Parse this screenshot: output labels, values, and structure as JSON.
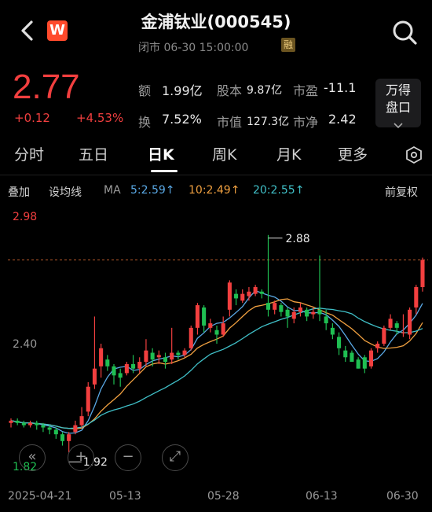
{
  "header": {
    "title": "金浦钛业(000545)",
    "status": "闭市 06-30 15:00:00",
    "margin_badge": "融",
    "logo_letter": "W"
  },
  "quote": {
    "price": "2.77",
    "change": "+0.12",
    "change_pct": "+4.53%",
    "stats": [
      {
        "label": "额",
        "value": "1.99亿"
      },
      {
        "label": "股本",
        "value": "9.87亿"
      },
      {
        "label": "市盈",
        "value": "-11.1"
      },
      {
        "label": "换",
        "value": "7.52%"
      },
      {
        "label": "市值",
        "value": "127.3亿"
      },
      {
        "label": "市净",
        "value": "2.42"
      }
    ],
    "wan_button": {
      "line1": "万得",
      "line2": "盘口"
    }
  },
  "tabs": [
    "分时",
    "五日",
    "日K",
    "周K",
    "月K",
    "更多"
  ],
  "active_tab": "日K",
  "ma_row": {
    "overlay": "叠加",
    "set_ma": "设均线",
    "ma_label": "MA",
    "ma5": "5:2.59↑",
    "ma10": "10:2.49↑",
    "ma20": "20:2.55↑",
    "adjust": "前复权"
  },
  "colors": {
    "up": "#f23f3f",
    "down": "#1fbf52",
    "ma5": "#5aa9e6",
    "ma10": "#f0a040",
    "ma20": "#40c0c8"
  },
  "chart_data": {
    "type": "candlestick",
    "y_labels": {
      "top": "2.98",
      "mid": "2.40",
      "bottom": "1.82"
    },
    "ylim": [
      1.82,
      2.98
    ],
    "high_marker": "2.88",
    "low_marker": "1.92",
    "prev_close_line": 2.77,
    "x_labels": [
      "2025-04-21",
      "05-13",
      "05-28",
      "06-13",
      "06-30"
    ],
    "candles": [
      [
        2.05,
        2.06,
        2.03,
        2.07
      ],
      [
        2.06,
        2.05,
        2.04,
        2.07
      ],
      [
        2.05,
        2.04,
        2.03,
        2.06
      ],
      [
        2.04,
        2.05,
        2.03,
        2.06
      ],
      [
        2.05,
        2.04,
        2.02,
        2.06
      ],
      [
        2.04,
        2.03,
        2.01,
        2.05
      ],
      [
        2.03,
        2.02,
        2.0,
        2.04
      ],
      [
        2.02,
        2.0,
        1.98,
        2.03
      ],
      [
        2.0,
        1.97,
        1.95,
        2.01
      ],
      [
        1.97,
        2.0,
        1.92,
        2.01
      ],
      [
        2.01,
        2.04,
        2.0,
        2.06
      ],
      [
        2.04,
        2.08,
        2.03,
        2.12
      ],
      [
        2.1,
        2.21,
        2.08,
        2.23
      ],
      [
        2.22,
        2.29,
        2.2,
        2.52
      ],
      [
        2.3,
        2.38,
        2.25,
        2.4
      ],
      [
        2.33,
        2.3,
        2.28,
        2.35
      ],
      [
        2.3,
        2.26,
        2.22,
        2.31
      ],
      [
        2.27,
        2.25,
        2.21,
        2.29
      ],
      [
        2.27,
        2.31,
        2.26,
        2.32
      ],
      [
        2.31,
        2.29,
        2.27,
        2.35
      ],
      [
        2.29,
        2.32,
        2.27,
        2.34
      ],
      [
        2.32,
        2.37,
        2.3,
        2.42
      ],
      [
        2.36,
        2.33,
        2.3,
        2.38
      ],
      [
        2.34,
        2.35,
        2.31,
        2.37
      ],
      [
        2.34,
        2.32,
        2.29,
        2.36
      ],
      [
        2.33,
        2.36,
        2.31,
        2.47
      ],
      [
        2.36,
        2.35,
        2.33,
        2.37
      ],
      [
        2.35,
        2.37,
        2.34,
        2.38
      ],
      [
        2.38,
        2.47,
        2.37,
        2.48
      ],
      [
        2.47,
        2.57,
        2.44,
        2.58
      ],
      [
        2.56,
        2.48,
        2.45,
        2.57
      ],
      [
        2.47,
        2.49,
        2.45,
        2.51
      ],
      [
        2.46,
        2.44,
        2.4,
        2.48
      ],
      [
        2.44,
        2.49,
        2.43,
        2.52
      ],
      [
        2.55,
        2.67,
        2.52,
        2.68
      ],
      [
        2.62,
        2.6,
        2.57,
        2.64
      ],
      [
        2.59,
        2.62,
        2.58,
        2.64
      ],
      [
        2.61,
        2.63,
        2.59,
        2.65
      ],
      [
        2.62,
        2.65,
        2.61,
        2.66
      ],
      [
        2.63,
        2.62,
        2.6,
        2.64
      ],
      [
        2.58,
        2.55,
        2.52,
        2.88
      ],
      [
        2.55,
        2.58,
        2.53,
        2.59
      ],
      [
        2.57,
        2.54,
        2.52,
        2.58
      ],
      [
        2.55,
        2.52,
        2.47,
        2.56
      ],
      [
        2.51,
        2.54,
        2.49,
        2.56
      ],
      [
        2.54,
        2.56,
        2.52,
        2.58
      ],
      [
        2.55,
        2.52,
        2.5,
        2.56
      ],
      [
        2.53,
        2.54,
        2.51,
        2.56
      ],
      [
        2.55,
        2.53,
        2.5,
        2.79
      ],
      [
        2.52,
        2.49,
        2.46,
        2.55
      ],
      [
        2.47,
        2.44,
        2.42,
        2.49
      ],
      [
        2.43,
        2.38,
        2.35,
        2.45
      ],
      [
        2.37,
        2.34,
        2.32,
        2.39
      ],
      [
        2.36,
        2.32,
        2.32,
        2.37
      ],
      [
        2.33,
        2.29,
        2.29,
        2.34
      ],
      [
        2.34,
        2.29,
        2.27,
        2.35
      ],
      [
        2.3,
        2.37,
        2.29,
        2.38
      ],
      [
        2.38,
        2.4,
        2.36,
        2.41
      ],
      [
        2.4,
        2.47,
        2.39,
        2.48
      ],
      [
        2.47,
        2.51,
        2.46,
        2.53
      ],
      [
        2.49,
        2.47,
        2.44,
        2.5
      ],
      [
        2.45,
        2.45,
        2.43,
        2.53
      ],
      [
        2.44,
        2.55,
        2.42,
        2.56
      ],
      [
        2.56,
        2.65,
        2.53,
        2.66
      ],
      [
        2.65,
        2.77,
        2.63,
        2.78
      ]
    ]
  },
  "chart_controls": [
    "«",
    "+",
    "−",
    "⤢"
  ]
}
